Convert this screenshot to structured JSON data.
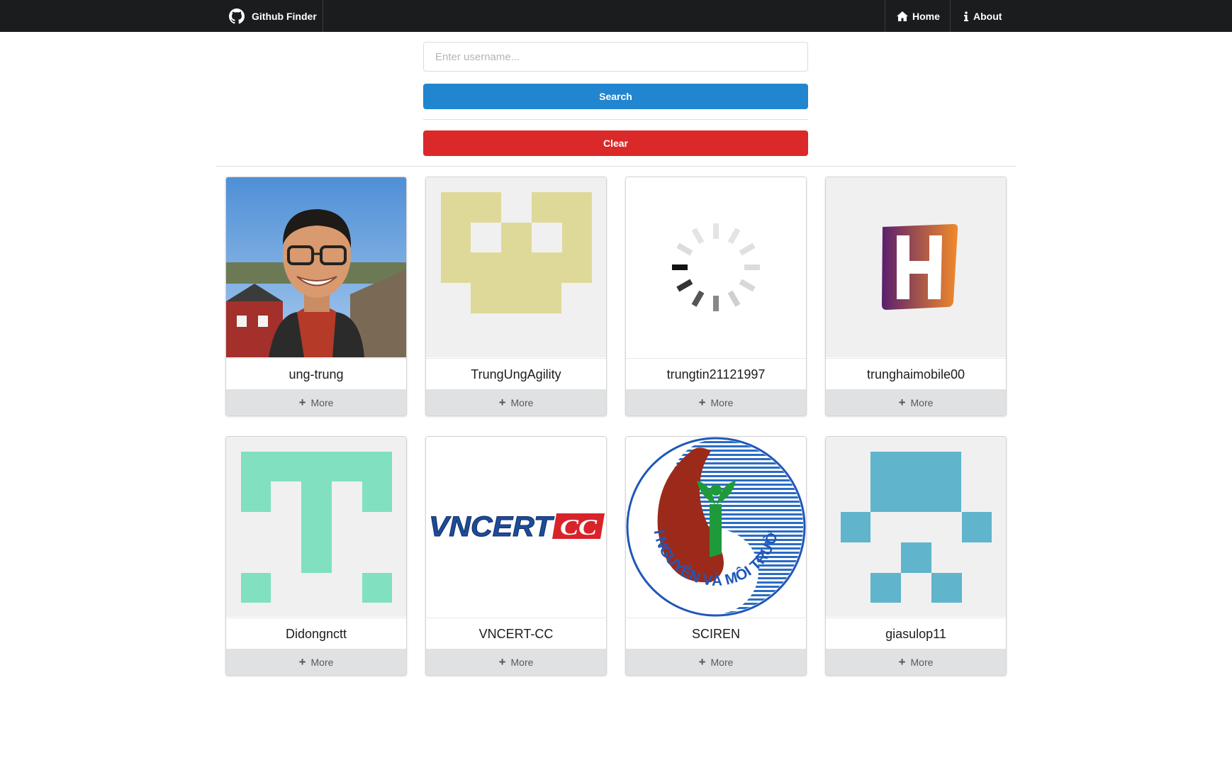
{
  "navbar": {
    "brand": "Github Finder",
    "home": "Home",
    "about": "About"
  },
  "search": {
    "placeholder": "Enter username...",
    "value": "",
    "search_label": "Search",
    "clear_label": "Clear"
  },
  "users": [
    {
      "login": "ung-trung",
      "more": "More",
      "avatar": "photo"
    },
    {
      "login": "TrungUngAgility",
      "more": "More",
      "avatar": "identicon",
      "color": "#dfd999"
    },
    {
      "login": "trungtin21121997",
      "more": "More",
      "avatar": "spinner"
    },
    {
      "login": "trunghaimobile00",
      "more": "More",
      "avatar": "h-logo"
    },
    {
      "login": "Didongnctt",
      "more": "More",
      "avatar": "identicon",
      "color": "#80e0c0"
    },
    {
      "login": "VNCERT-CC",
      "more": "More",
      "avatar": "logo-text",
      "logo_text": "VNCERT",
      "logo_badge": "CC"
    },
    {
      "login": "SCIREN",
      "more": "More",
      "avatar": "emblem",
      "emblem_text": "TÀI NGUYÊN VÀ MÔI TRƯỜNG"
    },
    {
      "login": "giasulop11",
      "more": "More",
      "avatar": "identicon",
      "color": "#60b4cc"
    }
  ]
}
